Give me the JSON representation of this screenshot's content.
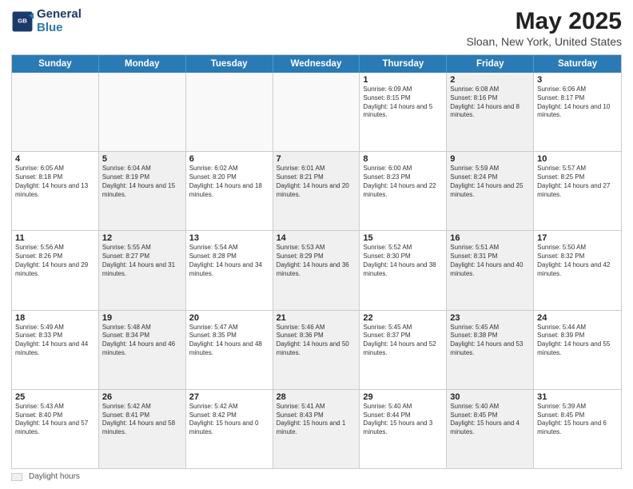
{
  "logo": {
    "line1": "General",
    "line2": "Blue"
  },
  "title": "May 2025",
  "subtitle": "Sloan, New York, United States",
  "header_days": [
    "Sunday",
    "Monday",
    "Tuesday",
    "Wednesday",
    "Thursday",
    "Friday",
    "Saturday"
  ],
  "legend_label": "Daylight hours",
  "weeks": [
    [
      {
        "day": "",
        "info": "",
        "shaded": false,
        "empty": true
      },
      {
        "day": "",
        "info": "",
        "shaded": false,
        "empty": true
      },
      {
        "day": "",
        "info": "",
        "shaded": false,
        "empty": true
      },
      {
        "day": "",
        "info": "",
        "shaded": false,
        "empty": true
      },
      {
        "day": "1",
        "info": "Sunrise: 6:09 AM\nSunset: 8:15 PM\nDaylight: 14 hours and 5 minutes.",
        "shaded": false,
        "empty": false
      },
      {
        "day": "2",
        "info": "Sunrise: 6:08 AM\nSunset: 8:16 PM\nDaylight: 14 hours and 8 minutes.",
        "shaded": true,
        "empty": false
      },
      {
        "day": "3",
        "info": "Sunrise: 6:06 AM\nSunset: 8:17 PM\nDaylight: 14 hours and 10 minutes.",
        "shaded": false,
        "empty": false
      }
    ],
    [
      {
        "day": "4",
        "info": "Sunrise: 6:05 AM\nSunset: 8:18 PM\nDaylight: 14 hours and 13 minutes.",
        "shaded": false,
        "empty": false
      },
      {
        "day": "5",
        "info": "Sunrise: 6:04 AM\nSunset: 8:19 PM\nDaylight: 14 hours and 15 minutes.",
        "shaded": true,
        "empty": false
      },
      {
        "day": "6",
        "info": "Sunrise: 6:02 AM\nSunset: 8:20 PM\nDaylight: 14 hours and 18 minutes.",
        "shaded": false,
        "empty": false
      },
      {
        "day": "7",
        "info": "Sunrise: 6:01 AM\nSunset: 8:21 PM\nDaylight: 14 hours and 20 minutes.",
        "shaded": true,
        "empty": false
      },
      {
        "day": "8",
        "info": "Sunrise: 6:00 AM\nSunset: 8:23 PM\nDaylight: 14 hours and 22 minutes.",
        "shaded": false,
        "empty": false
      },
      {
        "day": "9",
        "info": "Sunrise: 5:59 AM\nSunset: 8:24 PM\nDaylight: 14 hours and 25 minutes.",
        "shaded": true,
        "empty": false
      },
      {
        "day": "10",
        "info": "Sunrise: 5:57 AM\nSunset: 8:25 PM\nDaylight: 14 hours and 27 minutes.",
        "shaded": false,
        "empty": false
      }
    ],
    [
      {
        "day": "11",
        "info": "Sunrise: 5:56 AM\nSunset: 8:26 PM\nDaylight: 14 hours and 29 minutes.",
        "shaded": false,
        "empty": false
      },
      {
        "day": "12",
        "info": "Sunrise: 5:55 AM\nSunset: 8:27 PM\nDaylight: 14 hours and 31 minutes.",
        "shaded": true,
        "empty": false
      },
      {
        "day": "13",
        "info": "Sunrise: 5:54 AM\nSunset: 8:28 PM\nDaylight: 14 hours and 34 minutes.",
        "shaded": false,
        "empty": false
      },
      {
        "day": "14",
        "info": "Sunrise: 5:53 AM\nSunset: 8:29 PM\nDaylight: 14 hours and 36 minutes.",
        "shaded": true,
        "empty": false
      },
      {
        "day": "15",
        "info": "Sunrise: 5:52 AM\nSunset: 8:30 PM\nDaylight: 14 hours and 38 minutes.",
        "shaded": false,
        "empty": false
      },
      {
        "day": "16",
        "info": "Sunrise: 5:51 AM\nSunset: 8:31 PM\nDaylight: 14 hours and 40 minutes.",
        "shaded": true,
        "empty": false
      },
      {
        "day": "17",
        "info": "Sunrise: 5:50 AM\nSunset: 8:32 PM\nDaylight: 14 hours and 42 minutes.",
        "shaded": false,
        "empty": false
      }
    ],
    [
      {
        "day": "18",
        "info": "Sunrise: 5:49 AM\nSunset: 8:33 PM\nDaylight: 14 hours and 44 minutes.",
        "shaded": false,
        "empty": false
      },
      {
        "day": "19",
        "info": "Sunrise: 5:48 AM\nSunset: 8:34 PM\nDaylight: 14 hours and 46 minutes.",
        "shaded": true,
        "empty": false
      },
      {
        "day": "20",
        "info": "Sunrise: 5:47 AM\nSunset: 8:35 PM\nDaylight: 14 hours and 48 minutes.",
        "shaded": false,
        "empty": false
      },
      {
        "day": "21",
        "info": "Sunrise: 5:46 AM\nSunset: 8:36 PM\nDaylight: 14 hours and 50 minutes.",
        "shaded": true,
        "empty": false
      },
      {
        "day": "22",
        "info": "Sunrise: 5:45 AM\nSunset: 8:37 PM\nDaylight: 14 hours and 52 minutes.",
        "shaded": false,
        "empty": false
      },
      {
        "day": "23",
        "info": "Sunrise: 5:45 AM\nSunset: 8:38 PM\nDaylight: 14 hours and 53 minutes.",
        "shaded": true,
        "empty": false
      },
      {
        "day": "24",
        "info": "Sunrise: 5:44 AM\nSunset: 8:39 PM\nDaylight: 14 hours and 55 minutes.",
        "shaded": false,
        "empty": false
      }
    ],
    [
      {
        "day": "25",
        "info": "Sunrise: 5:43 AM\nSunset: 8:40 PM\nDaylight: 14 hours and 57 minutes.",
        "shaded": false,
        "empty": false
      },
      {
        "day": "26",
        "info": "Sunrise: 5:42 AM\nSunset: 8:41 PM\nDaylight: 14 hours and 58 minutes.",
        "shaded": true,
        "empty": false
      },
      {
        "day": "27",
        "info": "Sunrise: 5:42 AM\nSunset: 8:42 PM\nDaylight: 15 hours and 0 minutes.",
        "shaded": false,
        "empty": false
      },
      {
        "day": "28",
        "info": "Sunrise: 5:41 AM\nSunset: 8:43 PM\nDaylight: 15 hours and 1 minute.",
        "shaded": true,
        "empty": false
      },
      {
        "day": "29",
        "info": "Sunrise: 5:40 AM\nSunset: 8:44 PM\nDaylight: 15 hours and 3 minutes.",
        "shaded": false,
        "empty": false
      },
      {
        "day": "30",
        "info": "Sunrise: 5:40 AM\nSunset: 8:45 PM\nDaylight: 15 hours and 4 minutes.",
        "shaded": true,
        "empty": false
      },
      {
        "day": "31",
        "info": "Sunrise: 5:39 AM\nSunset: 8:45 PM\nDaylight: 15 hours and 6 minutes.",
        "shaded": false,
        "empty": false
      }
    ]
  ]
}
